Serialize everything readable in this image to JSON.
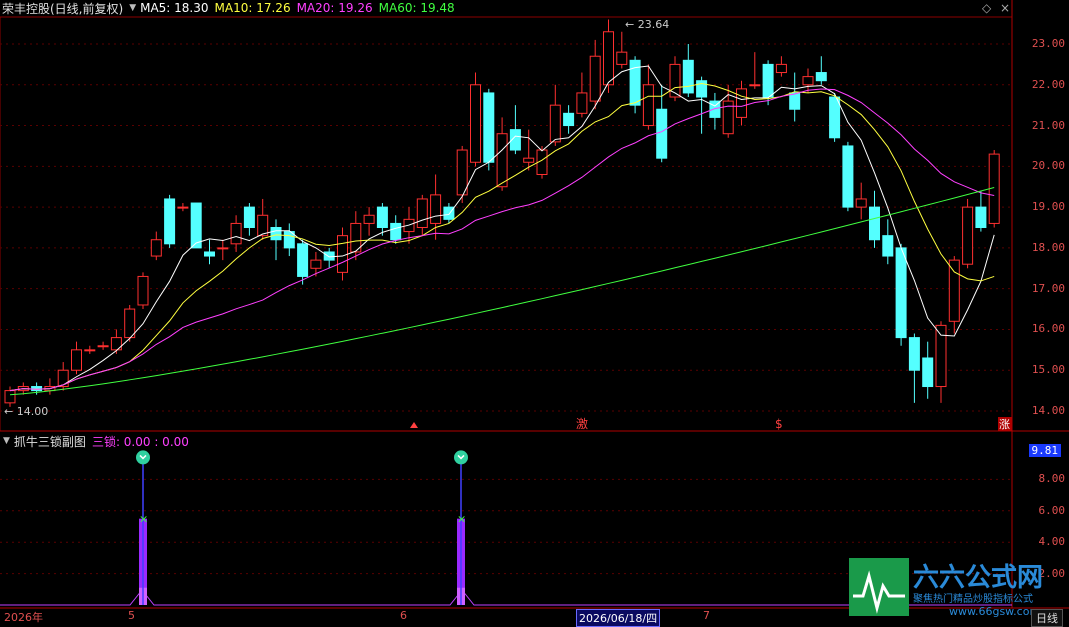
{
  "header": {
    "stock_title": "荣丰控股(日线,前复权)",
    "ma5": "MA5: 18.30",
    "ma10": "MA10: 17.26",
    "ma20": "MA20: 19.26",
    "ma60": "MA60: 19.48",
    "colors": {
      "ma5": "#ffffff",
      "ma10": "#ffff40",
      "ma20": "#ff40ff",
      "ma60": "#40ff40"
    }
  },
  "price_axis": [
    "23.00",
    "22.00",
    "21.00",
    "20.00",
    "19.00",
    "18.00",
    "17.00",
    "16.00",
    "15.00",
    "14.00"
  ],
  "annotations": {
    "high": "23.64",
    "low": "14.00",
    "marker_ji": "激",
    "marker_s": "$",
    "marker_zhang": "涨"
  },
  "sub": {
    "title": "抓牛三锁副图",
    "indicator": "三锁: 0.00 : 0.00",
    "axis": [
      "9.81",
      "8.00",
      "6.00",
      "4.00",
      "2.00"
    ]
  },
  "bottom": {
    "year": "2026年",
    "m5": "5",
    "m6": "6",
    "date": "2026/06/18/四",
    "m7": "7",
    "period": "日线"
  },
  "watermark": {
    "main": "六六公式网",
    "sub": "聚焦热门精品炒股指标公式",
    "url": "www.66gsw.com"
  },
  "icons": [
    "collapse-triangle-icon",
    "diamond-icon",
    "close-icon"
  ]
}
